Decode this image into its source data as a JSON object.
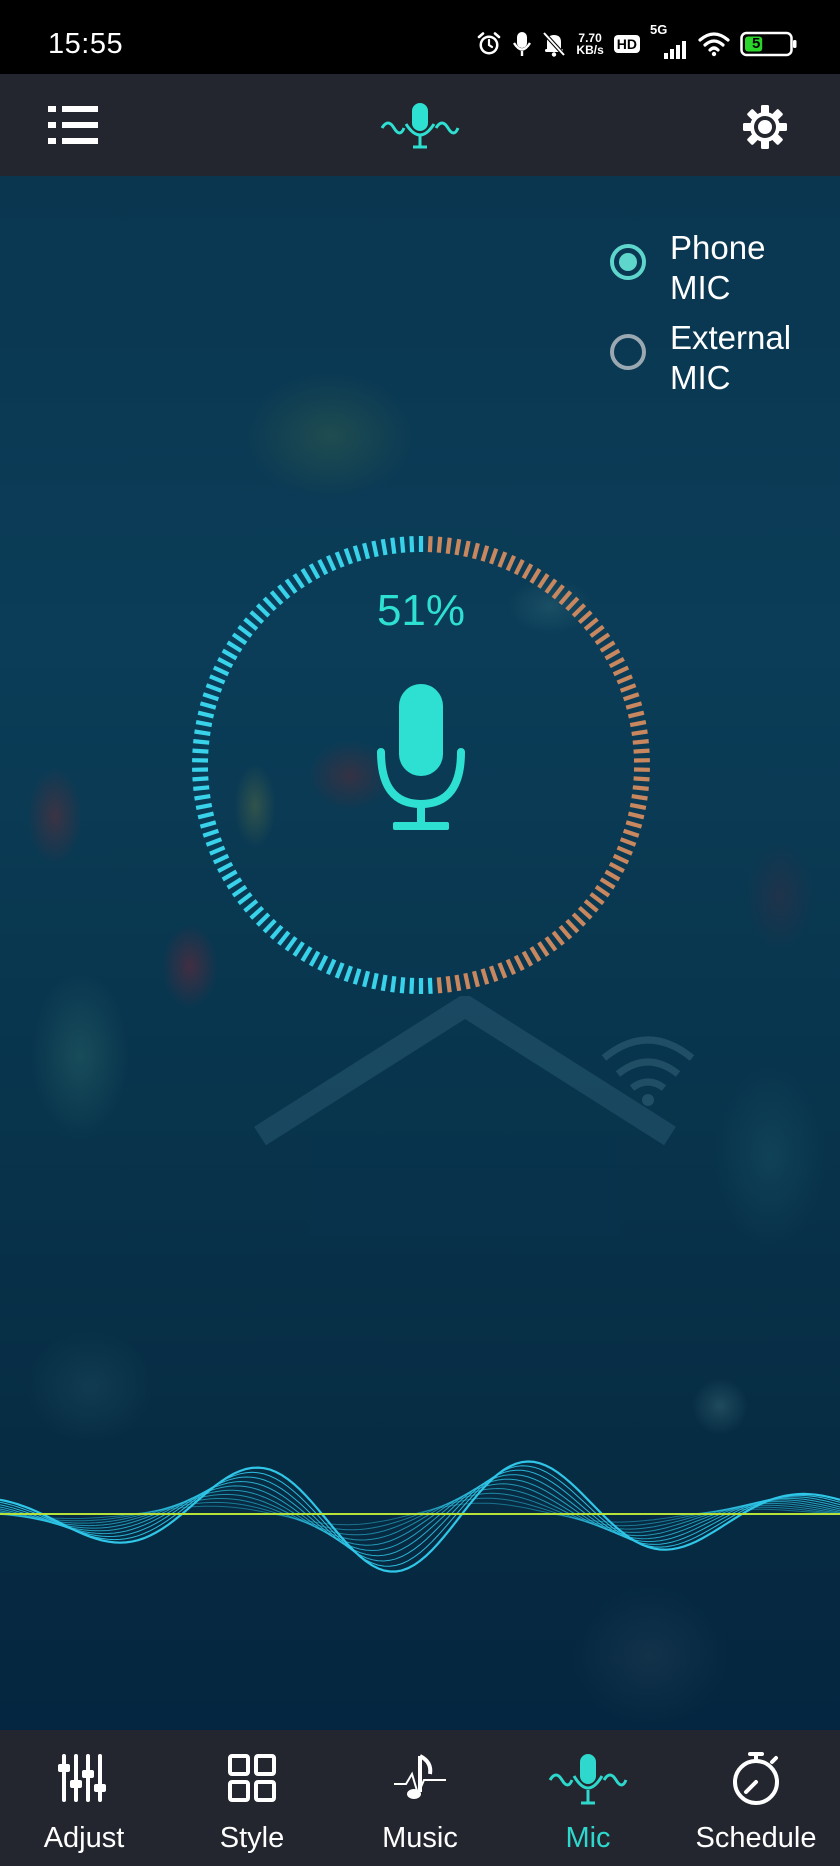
{
  "status_bar": {
    "time": "15:55",
    "net_speed_value": "7.70",
    "net_speed_unit": "KB/s",
    "hd_label": "HD",
    "network_type": "5G",
    "battery_level": "5",
    "battery_color": "#2bd42b"
  },
  "header": {
    "menu_icon": "list-icon",
    "logo_icon": "mic-wave-icon",
    "settings_icon": "gear-icon"
  },
  "mic_source": {
    "options": [
      {
        "label": "Phone MIC",
        "selected": true
      },
      {
        "label": "External MIC",
        "selected": false
      }
    ]
  },
  "level": {
    "percent_text": "51%",
    "value": 0.51,
    "active_color": "#38d3ea",
    "inactive_color": "#c8875e"
  },
  "colors": {
    "accent": "#2ee0d2",
    "header_bg": "#23262e",
    "wave_line": "#2fc6e8",
    "baseline": "#b7e23a"
  },
  "bottom_nav": {
    "items": [
      {
        "label": "Adjust",
        "icon": "sliders-icon",
        "active": false
      },
      {
        "label": "Style",
        "icon": "grid-icon",
        "active": false
      },
      {
        "label": "Music",
        "icon": "music-note-icon",
        "active": false
      },
      {
        "label": "Mic",
        "icon": "mic-wave-icon",
        "active": true
      },
      {
        "label": "Schedule",
        "icon": "stopwatch-icon",
        "active": false
      }
    ]
  }
}
